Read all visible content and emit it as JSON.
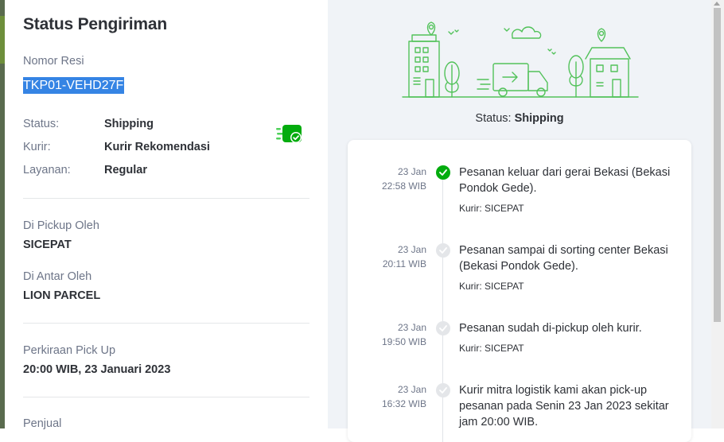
{
  "header": {
    "title": "Status Pengiriman"
  },
  "resi": {
    "label": "Nomor Resi",
    "value": "TKP01-VEHD27F"
  },
  "details": [
    {
      "label": "Status:",
      "value": "Shipping"
    },
    {
      "label": "Kurir:",
      "value": "Kurir Rekomendasi"
    },
    {
      "label": "Layanan:",
      "value": "Regular"
    }
  ],
  "pickup": {
    "label": "Di Pickup Oleh",
    "value": "SICEPAT"
  },
  "delivery": {
    "label": "Di Antar Oleh",
    "value": "LION PARCEL"
  },
  "estimate": {
    "label": "Perkiraan Pick Up",
    "value": "20:00 WIB, 23 Januari 2023"
  },
  "seller": {
    "label": "Penjual"
  },
  "status_summary": {
    "prefix": "Status:",
    "value": "Shipping"
  },
  "timeline": [
    {
      "date": "23 Jan",
      "time": "22:58 WIB",
      "text": "Pesanan keluar dari gerai Bekasi (Bekasi Pondok Gede).",
      "kurir": "Kurir: SICEPAT",
      "active": true
    },
    {
      "date": "23 Jan",
      "time": "20:11 WIB",
      "text": "Pesanan sampai di sorting center Bekasi (Bekasi Pondok Gede).",
      "kurir": "Kurir: SICEPAT",
      "active": false
    },
    {
      "date": "23 Jan",
      "time": "19:50 WIB",
      "text": "Pesanan sudah di-pickup oleh kurir.",
      "kurir": "Kurir: SICEPAT",
      "active": false
    },
    {
      "date": "23 Jan",
      "time": "16:32 WIB",
      "text": "Kurir mitra logistik kami akan pick-up pesanan pada Senin 23 Jan 2023 sekitar jam 20:00 WIB.",
      "kurir": "",
      "active": false
    }
  ],
  "colors": {
    "accent": "#03ac0e",
    "selection": "#3584e4",
    "panel_bg": "#f0f3f7"
  },
  "icons": {
    "shipping": "fast-delivery-check-icon",
    "check": "check-icon"
  }
}
